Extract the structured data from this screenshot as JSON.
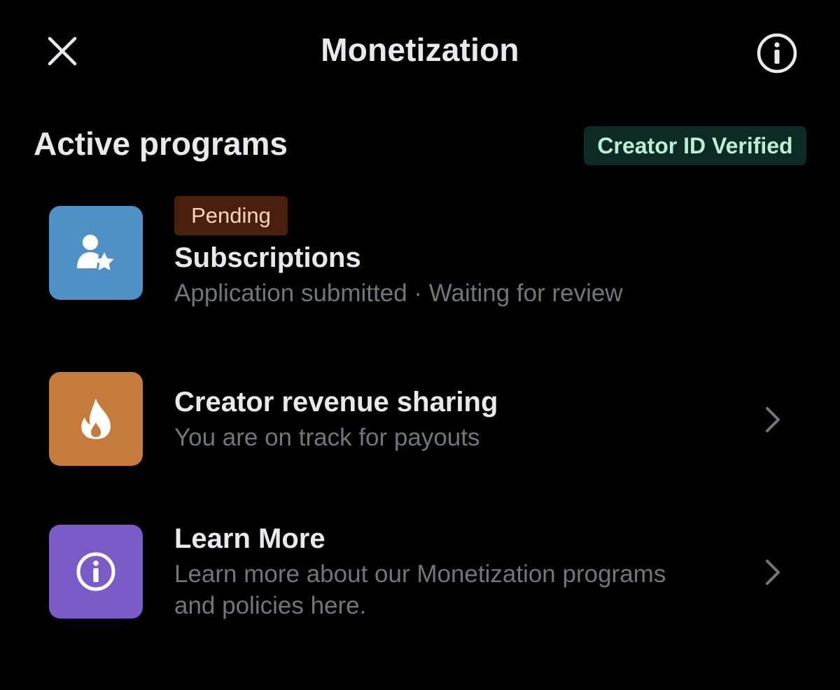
{
  "header": {
    "title": "Monetization",
    "close_icon": "close-icon",
    "info_icon": "info-icon"
  },
  "section": {
    "title": "Active programs",
    "badge": "Creator ID Verified"
  },
  "programs": [
    {
      "status": "Pending",
      "title": "Subscriptions",
      "subtitle": "Application submitted · Waiting for review",
      "icon": "person-star-icon",
      "color": "#4f90c7"
    },
    {
      "title": "Creator revenue sharing",
      "subtitle": "You are on track for payouts",
      "icon": "flame-icon",
      "color": "#c47b3b"
    },
    {
      "title": "Learn More",
      "subtitle": "Learn more about our Monetization programs and policies here.",
      "icon": "info-icon",
      "color": "#7b5cc7"
    }
  ],
  "colors": {
    "background": "#000000",
    "text_primary": "#e7e9ea",
    "text_secondary": "#71767b",
    "verified_badge_bg": "#0d2a24",
    "verified_badge_text": "#b9f0d5",
    "pending_badge_bg": "#4a1f0b",
    "pending_badge_text": "#f6d7bd"
  }
}
